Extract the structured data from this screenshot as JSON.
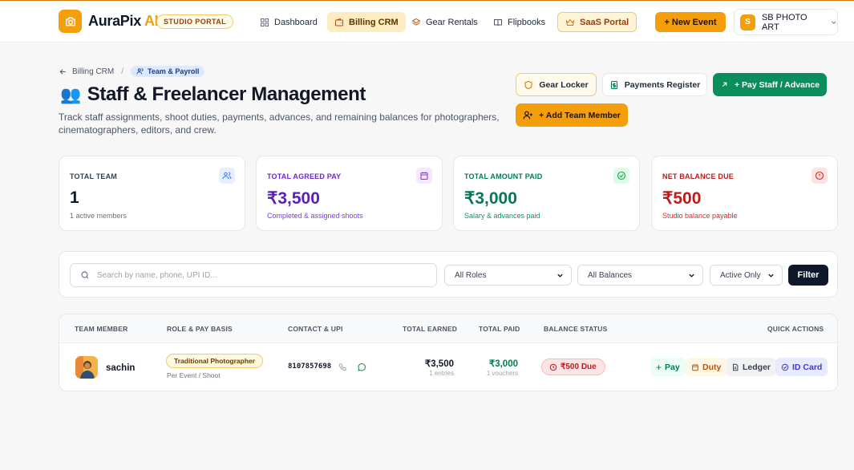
{
  "app": {
    "brand_main": "AuraPix",
    "brand_ai": "AI",
    "portal_badge": "STUDIO PORTAL"
  },
  "nav": [
    {
      "label": "Dashboard",
      "icon": "grid-icon"
    },
    {
      "label": "Billing CRM",
      "icon": "wallet-icon",
      "active": true
    },
    {
      "label": "Gear Rentals",
      "icon": "layers-icon"
    },
    {
      "label": "Flipbooks",
      "icon": "book-icon"
    },
    {
      "label": "SaaS Portal",
      "icon": "crown-icon"
    }
  ],
  "header": {
    "new_event": "+ New Event",
    "account_initial": "S",
    "account_name": "SB PHOTO ART"
  },
  "breadcrumb": {
    "parent": "Billing CRM",
    "separator": "/",
    "current": "Team & Payroll"
  },
  "page": {
    "emoji": "👥",
    "title": "Staff & Freelancer Management",
    "subtitle": "Track staff assignments, shoot duties, payments, advances, and remaining balances for photographers, cinematographers, editors, and crew."
  },
  "actions": {
    "gear_locker": "Gear Locker",
    "payments_register": "Payments Register",
    "pay_staff": "+ Pay Staff / Advance",
    "add_member": "+ Add Team Member"
  },
  "stats": [
    {
      "label": "TOTAL TEAM",
      "value": "1",
      "sub": "1 active members",
      "color": "#111827",
      "label_color": "#374151",
      "sub_color": "#6b7280",
      "icon": "users-icon",
      "icon_bg": "#e6efff",
      "icon_color": "#3b82f6"
    },
    {
      "label": "TOTAL AGREED PAY",
      "value": "₹3,500",
      "sub": "Completed & assigned shoots",
      "color": "#5b21b6",
      "label_color": "#6d28d9",
      "sub_color": "#7c3aed",
      "icon": "calendar-icon",
      "icon_bg": "#f3e8ff",
      "icon_color": "#9333ea"
    },
    {
      "label": "TOTAL AMOUNT PAID",
      "value": "₹3,000",
      "sub": "Salary & advances paid",
      "color": "#047857",
      "label_color": "#047857",
      "sub_color": "#059669",
      "icon": "check-circle-icon",
      "icon_bg": "#dcfce7",
      "icon_color": "#16a34a"
    },
    {
      "label": "NET BALANCE DUE",
      "value": "₹500",
      "sub": "Studio balance payable",
      "color": "#b91c1c",
      "label_color": "#b91c1c",
      "sub_color": "#dc2626",
      "icon": "alert-circle-icon",
      "icon_bg": "#fee2e2",
      "icon_color": "#dc2626"
    }
  ],
  "filters": {
    "search_placeholder": "Search by name, phone, UPI ID...",
    "role": "All Roles",
    "balance": "All Balances",
    "status": "Active Only",
    "button": "Filter"
  },
  "table": {
    "headers": [
      "TEAM MEMBER",
      "ROLE & PAY BASIS",
      "CONTACT & UPI",
      "TOTAL EARNED",
      "TOTAL PAID",
      "BALANCE STATUS",
      "QUICK ACTIONS"
    ],
    "rows": [
      {
        "name": "sachin",
        "role": "Traditional Photographer",
        "pay_basis": "Per Event / Shoot",
        "phone": "8107857698",
        "earned": "₹3,500",
        "earned_sub": "1 entries",
        "paid": "₹3,000",
        "paid_sub": "1 vouchers",
        "balance": "₹500 Due",
        "actions": {
          "pay": "Pay",
          "duty": "Duty",
          "ledger": "Ledger",
          "id_card": "ID Card"
        }
      }
    ]
  }
}
